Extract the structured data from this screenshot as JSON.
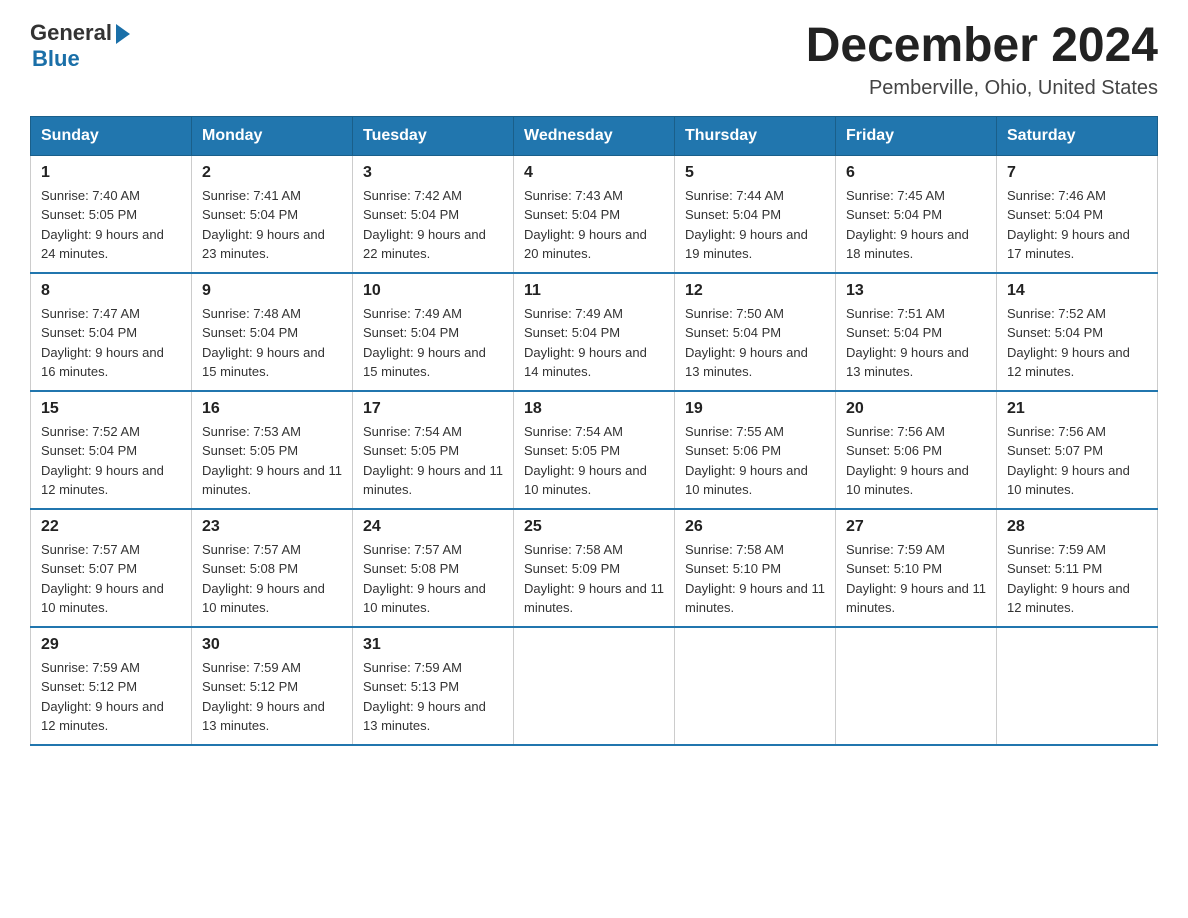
{
  "header": {
    "logo_general": "General",
    "logo_blue": "Blue",
    "month_title": "December 2024",
    "location": "Pemberville, Ohio, United States"
  },
  "days_of_week": [
    "Sunday",
    "Monday",
    "Tuesday",
    "Wednesday",
    "Thursday",
    "Friday",
    "Saturday"
  ],
  "weeks": [
    [
      {
        "day": "1",
        "sunrise": "7:40 AM",
        "sunset": "5:05 PM",
        "daylight": "9 hours and 24 minutes."
      },
      {
        "day": "2",
        "sunrise": "7:41 AM",
        "sunset": "5:04 PM",
        "daylight": "9 hours and 23 minutes."
      },
      {
        "day": "3",
        "sunrise": "7:42 AM",
        "sunset": "5:04 PM",
        "daylight": "9 hours and 22 minutes."
      },
      {
        "day": "4",
        "sunrise": "7:43 AM",
        "sunset": "5:04 PM",
        "daylight": "9 hours and 20 minutes."
      },
      {
        "day": "5",
        "sunrise": "7:44 AM",
        "sunset": "5:04 PM",
        "daylight": "9 hours and 19 minutes."
      },
      {
        "day": "6",
        "sunrise": "7:45 AM",
        "sunset": "5:04 PM",
        "daylight": "9 hours and 18 minutes."
      },
      {
        "day": "7",
        "sunrise": "7:46 AM",
        "sunset": "5:04 PM",
        "daylight": "9 hours and 17 minutes."
      }
    ],
    [
      {
        "day": "8",
        "sunrise": "7:47 AM",
        "sunset": "5:04 PM",
        "daylight": "9 hours and 16 minutes."
      },
      {
        "day": "9",
        "sunrise": "7:48 AM",
        "sunset": "5:04 PM",
        "daylight": "9 hours and 15 minutes."
      },
      {
        "day": "10",
        "sunrise": "7:49 AM",
        "sunset": "5:04 PM",
        "daylight": "9 hours and 15 minutes."
      },
      {
        "day": "11",
        "sunrise": "7:49 AM",
        "sunset": "5:04 PM",
        "daylight": "9 hours and 14 minutes."
      },
      {
        "day": "12",
        "sunrise": "7:50 AM",
        "sunset": "5:04 PM",
        "daylight": "9 hours and 13 minutes."
      },
      {
        "day": "13",
        "sunrise": "7:51 AM",
        "sunset": "5:04 PM",
        "daylight": "9 hours and 13 minutes."
      },
      {
        "day": "14",
        "sunrise": "7:52 AM",
        "sunset": "5:04 PM",
        "daylight": "9 hours and 12 minutes."
      }
    ],
    [
      {
        "day": "15",
        "sunrise": "7:52 AM",
        "sunset": "5:04 PM",
        "daylight": "9 hours and 12 minutes."
      },
      {
        "day": "16",
        "sunrise": "7:53 AM",
        "sunset": "5:05 PM",
        "daylight": "9 hours and 11 minutes."
      },
      {
        "day": "17",
        "sunrise": "7:54 AM",
        "sunset": "5:05 PM",
        "daylight": "9 hours and 11 minutes."
      },
      {
        "day": "18",
        "sunrise": "7:54 AM",
        "sunset": "5:05 PM",
        "daylight": "9 hours and 10 minutes."
      },
      {
        "day": "19",
        "sunrise": "7:55 AM",
        "sunset": "5:06 PM",
        "daylight": "9 hours and 10 minutes."
      },
      {
        "day": "20",
        "sunrise": "7:56 AM",
        "sunset": "5:06 PM",
        "daylight": "9 hours and 10 minutes."
      },
      {
        "day": "21",
        "sunrise": "7:56 AM",
        "sunset": "5:07 PM",
        "daylight": "9 hours and 10 minutes."
      }
    ],
    [
      {
        "day": "22",
        "sunrise": "7:57 AM",
        "sunset": "5:07 PM",
        "daylight": "9 hours and 10 minutes."
      },
      {
        "day": "23",
        "sunrise": "7:57 AM",
        "sunset": "5:08 PM",
        "daylight": "9 hours and 10 minutes."
      },
      {
        "day": "24",
        "sunrise": "7:57 AM",
        "sunset": "5:08 PM",
        "daylight": "9 hours and 10 minutes."
      },
      {
        "day": "25",
        "sunrise": "7:58 AM",
        "sunset": "5:09 PM",
        "daylight": "9 hours and 11 minutes."
      },
      {
        "day": "26",
        "sunrise": "7:58 AM",
        "sunset": "5:10 PM",
        "daylight": "9 hours and 11 minutes."
      },
      {
        "day": "27",
        "sunrise": "7:59 AM",
        "sunset": "5:10 PM",
        "daylight": "9 hours and 11 minutes."
      },
      {
        "day": "28",
        "sunrise": "7:59 AM",
        "sunset": "5:11 PM",
        "daylight": "9 hours and 12 minutes."
      }
    ],
    [
      {
        "day": "29",
        "sunrise": "7:59 AM",
        "sunset": "5:12 PM",
        "daylight": "9 hours and 12 minutes."
      },
      {
        "day": "30",
        "sunrise": "7:59 AM",
        "sunset": "5:12 PM",
        "daylight": "9 hours and 13 minutes."
      },
      {
        "day": "31",
        "sunrise": "7:59 AM",
        "sunset": "5:13 PM",
        "daylight": "9 hours and 13 minutes."
      },
      null,
      null,
      null,
      null
    ]
  ]
}
